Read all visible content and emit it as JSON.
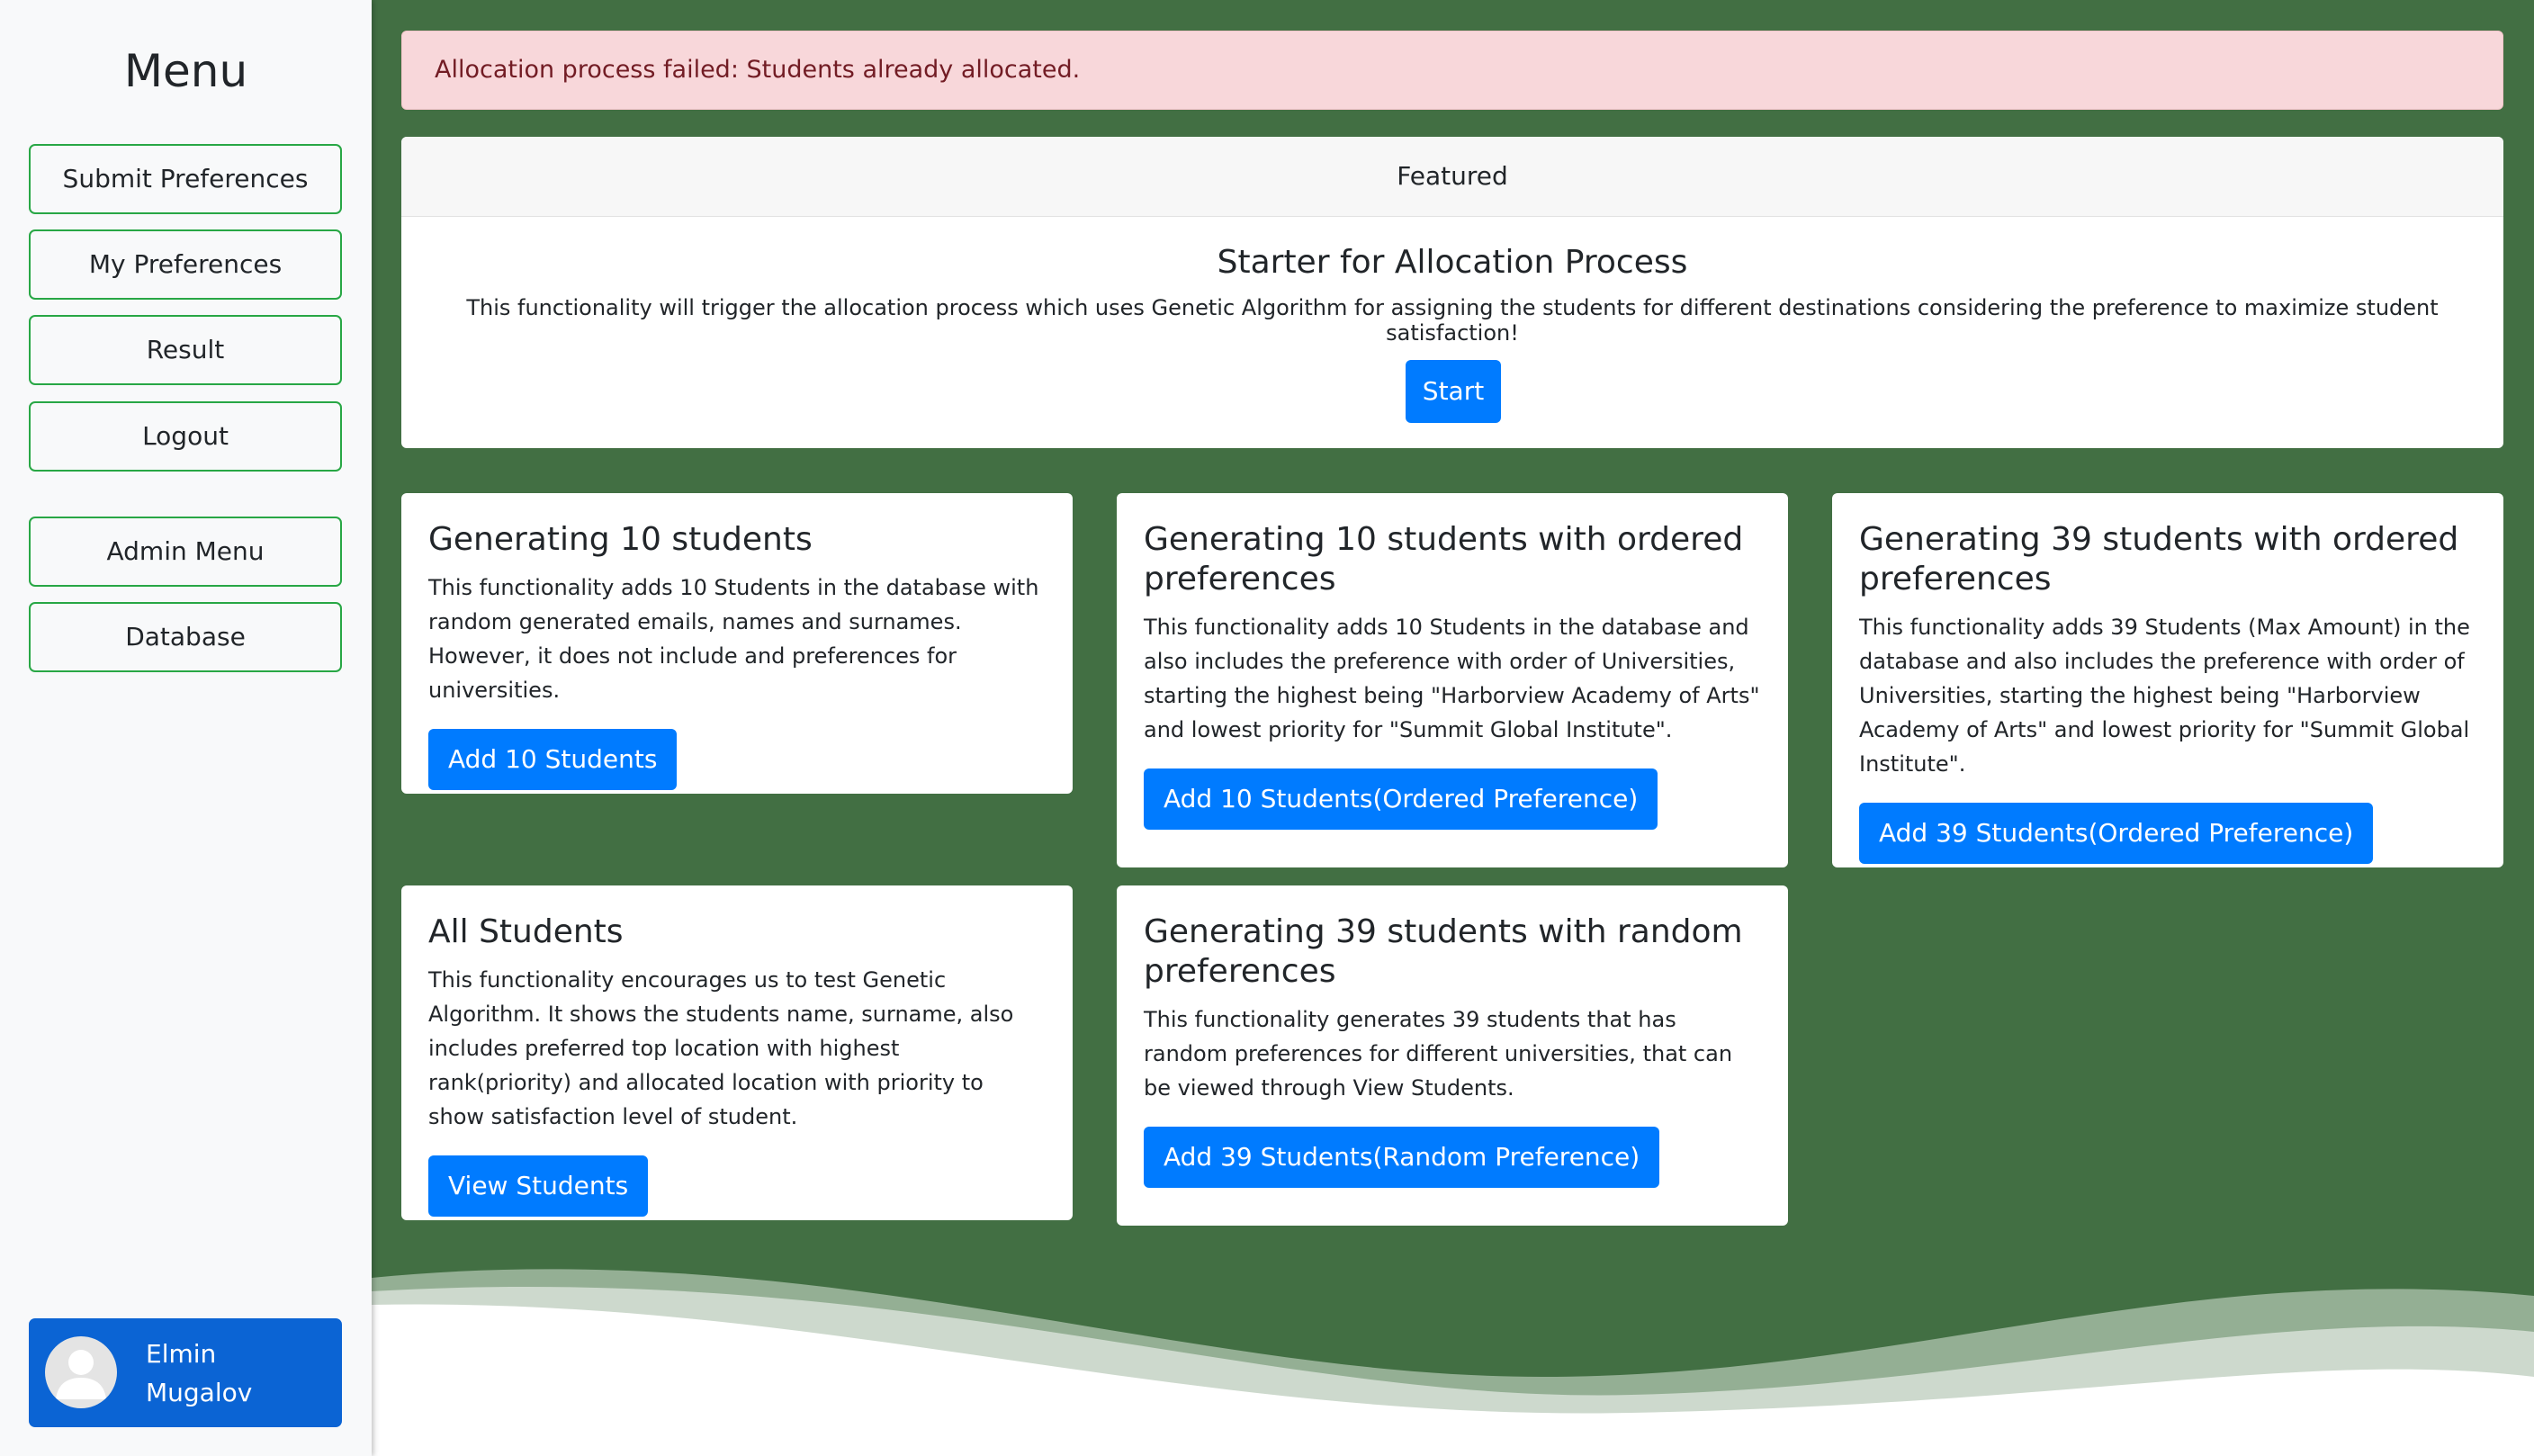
{
  "sidebar": {
    "title": "Menu",
    "items": [
      {
        "label": "Submit Preferences"
      },
      {
        "label": "My Preferences"
      },
      {
        "label": "Result"
      },
      {
        "label": "Logout"
      },
      {
        "label": "Admin Menu"
      },
      {
        "label": "Database"
      }
    ],
    "user": {
      "first_name": "Elmin",
      "last_name": "Mugalov"
    }
  },
  "alert": {
    "text": "Allocation process failed: Students already allocated."
  },
  "featured": {
    "header": "Featured",
    "title": "Starter for Allocation Process",
    "text": "This functionality will trigger the allocation process which uses Genetic Algorithm for assigning the students for different destinations considering the preference to maximize student satisfaction!",
    "button": "Start"
  },
  "cards": [
    {
      "title": "Generating 10 students",
      "text": "This functionality adds 10 Students in the database with random generated emails, names and surnames. However, it does not include and preferences for universities.",
      "button": "Add 10 Students"
    },
    {
      "title": "Generating 10 students with ordered preferences",
      "text": "This functionality adds 10 Students in the database and also includes the preference with order of Universities, starting the highest being \"Harborview Academy of Arts\" and lowest priority for \"Summit Global Institute\".",
      "button": "Add 10 Students(Ordered Preference)"
    },
    {
      "title": "Generating 39 students with ordered preferences",
      "text": "This functionality adds 39 Students (Max Amount) in the database and also includes the preference with order of Universities, starting the highest being \"Harborview Academy of Arts\" and lowest priority for \"Summit Global Institute\".",
      "button": "Add 39 Students(Ordered Preference)"
    },
    {
      "title": "All Students",
      "text": "This functionality encourages us to test Genetic Algorithm. It shows the students name, surname, also includes preferred top location with highest rank(priority) and allocated location with priority to show satisfaction level of student.",
      "button": "View Students"
    },
    {
      "title": "Generating 39 students with random preferences",
      "text": "This functionality generates 39 students that has random preferences for different universities, that can be viewed through View Students.",
      "button": "Add 39 Students(Random Preference)"
    }
  ],
  "colors": {
    "background": "#426f43",
    "sidebar": "#f8f9fa",
    "primary": "#007bff",
    "success_border": "#28a745",
    "alert_bg": "#f8d7da",
    "alert_text": "#721c24",
    "user_card": "#0b64d4"
  }
}
